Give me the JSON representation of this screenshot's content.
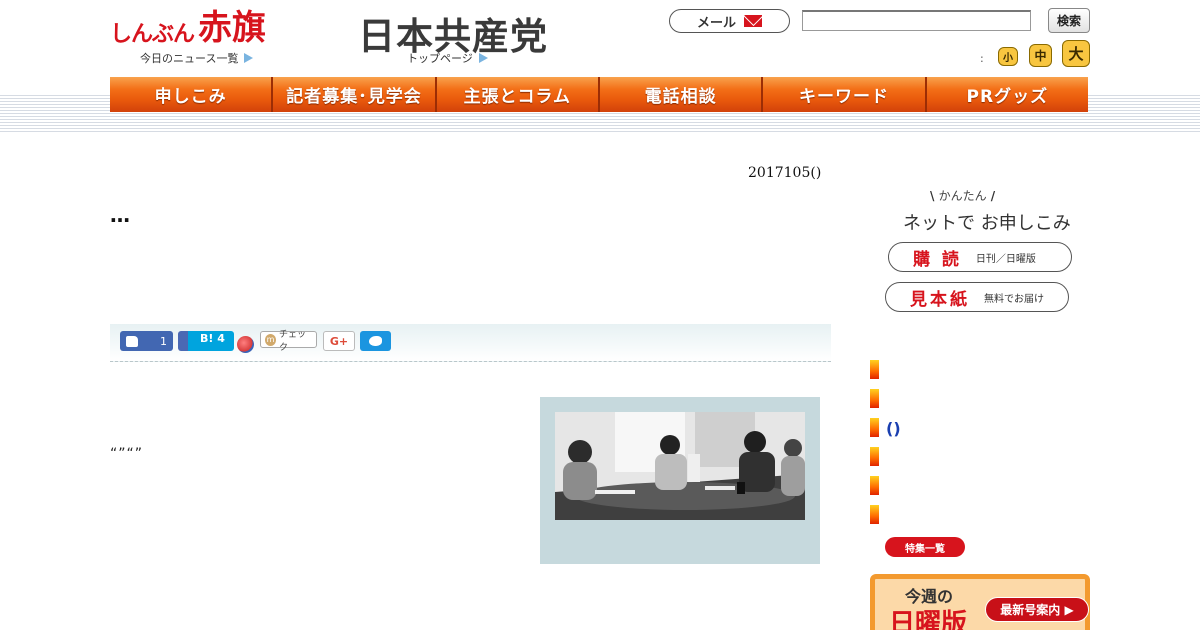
{
  "header": {
    "akahata_logo_small": "しんぶん",
    "akahata_logo_big": "赤旗",
    "jcp_logo": "日本共産党",
    "todays_news_link": "今日のニュース一覧",
    "top_page_link": "トップページ",
    "mail_button": "メール",
    "search_value": "",
    "search_button": "検索",
    "font_size_colon": ":",
    "font_small": "小",
    "font_medium": "中",
    "font_large": "大"
  },
  "nav": {
    "items": [
      "申しこみ",
      "記者募集･見学会",
      "主張とコラム",
      "電話相談",
      "キーワード",
      "PRグッズ"
    ]
  },
  "article": {
    "date": "2017105()",
    "headline": "…",
    "body_quotes": "“”“”",
    "like_count": "1",
    "hatena_label": "B! 4",
    "mixi_check_label": "チェック",
    "gplus_label": "G+"
  },
  "sidebar": {
    "signup_tag": "かんたん",
    "signup_main": "ネットで お申しこみ",
    "subscribe_big": "購 読",
    "subscribe_small": "日刊／日曜版",
    "sample_big": "見本紙",
    "sample_small": "無料でお届け",
    "list_paren": "()",
    "feature_list_button": "特集一覧",
    "sunday_line1": "今週の",
    "sunday_line2": "日曜版",
    "latest_issue_button": "最新号案内 ▶"
  },
  "colors": {
    "brand_red": "#d7141d",
    "nav_orange": "#f36f17",
    "font_size_yellow": "#f8c640",
    "photo_panel": "#c6d9dd"
  }
}
